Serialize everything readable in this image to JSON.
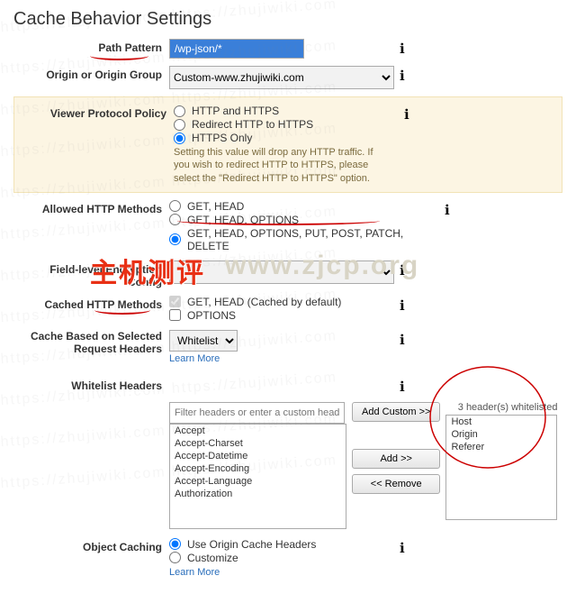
{
  "page_title": "Cache Behavior Settings",
  "path_pattern": {
    "label": "Path Pattern",
    "value": "/wp-json/*"
  },
  "origin": {
    "label": "Origin or Origin Group",
    "value": "Custom-www.zhujiwiki.com"
  },
  "protocol": {
    "label": "Viewer Protocol Policy",
    "opt1": "HTTP and HTTPS",
    "opt2": "Redirect HTTP to HTTPS",
    "opt3": "HTTPS Only",
    "hint": "Setting this value will drop any HTTP traffic. If you wish to redirect HTTP to HTTPS, please select the \"Redirect HTTP to HTTPS\" option."
  },
  "methods": {
    "label": "Allowed HTTP Methods",
    "opt1": "GET, HEAD",
    "opt2": "GET, HEAD, OPTIONS",
    "opt3": "GET, HEAD, OPTIONS, PUT, POST, PATCH, DELETE"
  },
  "enc": {
    "label": "Field-level Encryption Config",
    "value": ""
  },
  "cached_methods": {
    "label": "Cached HTTP Methods",
    "opt1": "GET, HEAD (Cached by default)",
    "opt2": "OPTIONS"
  },
  "cache_headers": {
    "label": "Cache Based on Selected Request Headers",
    "value": "Whitelist",
    "learn": "Learn More"
  },
  "whitelist": {
    "label": "Whitelist Headers",
    "filter_placeholder": "Filter headers or enter a custom header",
    "options": [
      "Accept",
      "Accept-Charset",
      "Accept-Datetime",
      "Accept-Encoding",
      "Accept-Language",
      "Authorization"
    ],
    "addcustom": "Add Custom >>",
    "add": "Add >>",
    "remove": "<< Remove",
    "count_label": "3 header(s) whitelisted",
    "selected": [
      "Host",
      "Origin",
      "Referer"
    ]
  },
  "obj_cache": {
    "label": "Object Caching",
    "opt1": "Use Origin Cache Headers",
    "opt2": "Customize",
    "learn": "Learn More"
  },
  "info": "ℹ",
  "watermark_cn": "主机测评",
  "watermark_en": "www.zjcp.org",
  "bg_mark": "https://zhujiwiki.com  https://zhujiwiki.com"
}
